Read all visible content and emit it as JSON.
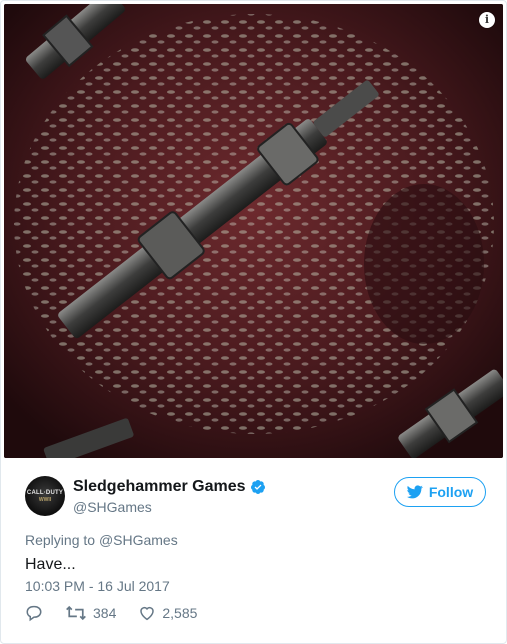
{
  "media": {
    "description_icon": "info-icon"
  },
  "info_label": "i",
  "author": {
    "avatar_line1": "CALL·DUTY",
    "avatar_line2": "WWII",
    "display_name": "Sledgehammer Games",
    "handle": "@SHGames",
    "verified": true
  },
  "follow_button": {
    "label": "Follow",
    "icon": "bird-icon"
  },
  "reply": {
    "prefix": "Replying to ",
    "mention": "@SHGames"
  },
  "text": "Have...",
  "timestamp": "10:03 PM - 16 Jul 2017",
  "stats": {
    "reply_icon": "reply-icon",
    "retweet_icon": "retweet-icon",
    "retweets": "384",
    "like_icon": "heart-icon",
    "likes": "2,585"
  },
  "colors": {
    "accent": "#1da1f2",
    "secondary_text": "#657786",
    "primary_text": "#14171a"
  }
}
